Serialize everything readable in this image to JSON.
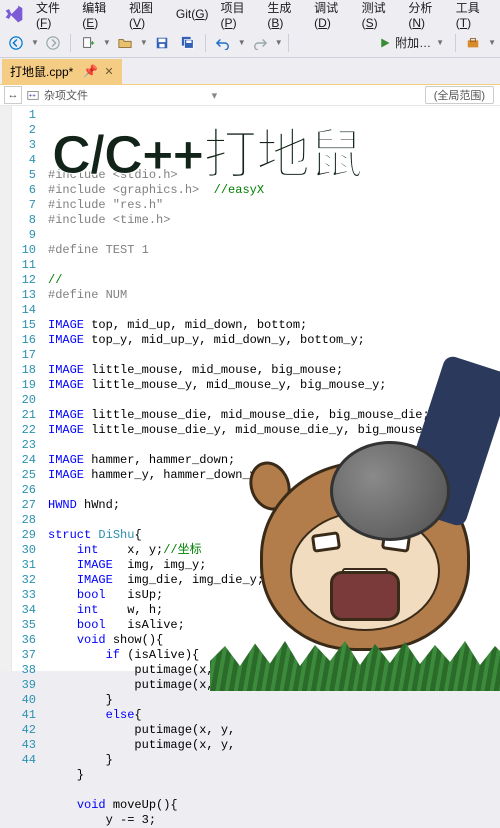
{
  "menu": {
    "items": [
      {
        "label": "文件",
        "key": "F"
      },
      {
        "label": "编辑",
        "key": "E"
      },
      {
        "label": "视图",
        "key": "V"
      },
      {
        "label": "Git",
        "key": "G"
      },
      {
        "label": "项目",
        "key": "P"
      },
      {
        "label": "生成",
        "key": "B"
      },
      {
        "label": "调试",
        "key": "D"
      },
      {
        "label": "测试",
        "key": "S"
      },
      {
        "label": "分析",
        "key": "N"
      },
      {
        "label": "工具",
        "key": "T"
      }
    ]
  },
  "toolbar": {
    "run_label": "附加…"
  },
  "tabs": {
    "active": {
      "label": "打地鼠.cpp*"
    }
  },
  "breadcrumb": {
    "context": "杂项文件",
    "scope": "(全局范围)"
  },
  "overlay": {
    "title": "C/C++打地鼠"
  },
  "code": {
    "lines": [
      {
        "n": 1,
        "t": "#include <stdio.h>",
        "cls": "pp"
      },
      {
        "n": 2,
        "t": "#include <graphics.h>  //easyX",
        "cls": "pp",
        "cmt": "//easyX"
      },
      {
        "n": 3,
        "t": "#include \"res.h\"",
        "cls": "pp"
      },
      {
        "n": 4,
        "t": "#include <time.h>",
        "cls": "pp"
      },
      {
        "n": 5,
        "t": "",
        "cls": ""
      },
      {
        "n": 6,
        "t": "#define TEST 1",
        "cls": "pp"
      },
      {
        "n": 7,
        "t": "",
        "cls": ""
      },
      {
        "n": 8,
        "t": "//",
        "cls": "cmt"
      },
      {
        "n": 9,
        "t": "#define NUM",
        "cls": "pp"
      },
      {
        "n": 10,
        "t": "",
        "cls": ""
      },
      {
        "n": 11,
        "t": "IMAGE top, mid_up, mid_down, bottom;",
        "cls": ""
      },
      {
        "n": 12,
        "t": "IMAGE top_y, mid_up_y, mid_down_y, bottom_y;",
        "cls": ""
      },
      {
        "n": 13,
        "t": "",
        "cls": ""
      },
      {
        "n": 14,
        "t": "IMAGE little_mouse, mid_mouse, big_mouse;",
        "cls": ""
      },
      {
        "n": 15,
        "t": "IMAGE little_mouse_y, mid_mouse_y, big_mouse_y;",
        "cls": ""
      },
      {
        "n": 16,
        "t": "",
        "cls": ""
      },
      {
        "n": 17,
        "t": "IMAGE little_mouse_die, mid_mouse_die, big_mouse_die;",
        "cls": ""
      },
      {
        "n": 18,
        "t": "IMAGE little_mouse_die_y, mid_mouse_die_y, big_mouse_die_y;",
        "cls": ""
      },
      {
        "n": 19,
        "t": "",
        "cls": ""
      },
      {
        "n": 20,
        "t": "IMAGE hammer, hammer_down;",
        "cls": ""
      },
      {
        "n": 21,
        "t": "IMAGE hammer_y, hammer_down_y;",
        "cls": ""
      },
      {
        "n": 22,
        "t": "",
        "cls": ""
      },
      {
        "n": 23,
        "t": "HWND hWnd;",
        "cls": ""
      },
      {
        "n": 24,
        "t": "",
        "cls": ""
      },
      {
        "n": 25,
        "t": "struct DiShu{",
        "cls": "kw",
        "struct": true
      },
      {
        "n": 26,
        "t": "    int    x, y;//坐标",
        "cls": "",
        "cmt": "//坐标"
      },
      {
        "n": 27,
        "t": "    IMAGE  img, img_y;",
        "cls": ""
      },
      {
        "n": 28,
        "t": "    IMAGE  img_die, img_die_y;",
        "cls": ""
      },
      {
        "n": 29,
        "t": "    bool   isUp;",
        "cls": ""
      },
      {
        "n": 30,
        "t": "    int    w, h;",
        "cls": ""
      },
      {
        "n": 31,
        "t": "    bool   isAlive;",
        "cls": ""
      },
      {
        "n": 32,
        "t": "    void show(){",
        "cls": "kw"
      },
      {
        "n": 33,
        "t": "        if (isAlive){",
        "cls": "kw"
      },
      {
        "n": 34,
        "t": "            putimage(x, y, &img",
        "cls": ""
      },
      {
        "n": 35,
        "t": "            putimage(x, y, &img",
        "cls": ""
      },
      {
        "n": 36,
        "t": "        }",
        "cls": ""
      },
      {
        "n": 37,
        "t": "        else{",
        "cls": "kw"
      },
      {
        "n": 38,
        "t": "            putimage(x, y,",
        "cls": ""
      },
      {
        "n": 39,
        "t": "            putimage(x, y,",
        "cls": ""
      },
      {
        "n": 40,
        "t": "        }",
        "cls": ""
      },
      {
        "n": 41,
        "t": "    }",
        "cls": ""
      },
      {
        "n": 42,
        "t": "",
        "cls": ""
      },
      {
        "n": 43,
        "t": "    void moveUp(){",
        "cls": "kw"
      },
      {
        "n": 44,
        "t": "        y -= 3;",
        "cls": ""
      }
    ]
  }
}
